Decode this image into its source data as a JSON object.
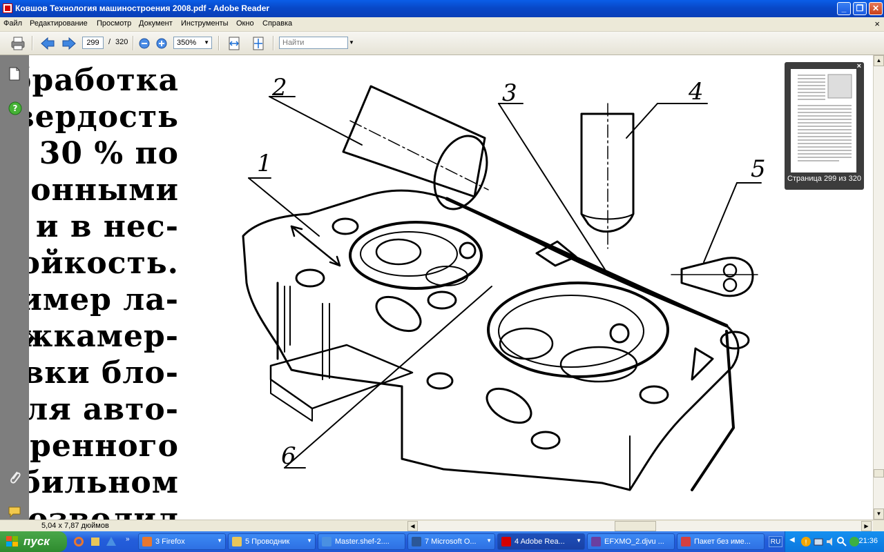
{
  "window": {
    "title": "Ковшов Технология машиностроения 2008.pdf - Adobe Reader",
    "minimize_glyph": "_",
    "maximize_glyph": "❐",
    "close_glyph": "✕"
  },
  "menu": {
    "items": [
      "Файл",
      "Редактирование",
      "Просмотр",
      "Документ",
      "Инструменты",
      "Окно",
      "Справка"
    ],
    "close_glyph": "×"
  },
  "toolbar": {
    "current_page": "299",
    "page_separator": "/",
    "total_pages": "320",
    "zoom": "350%",
    "search_placeholder": "Найти"
  },
  "document": {
    "text_lines": [
      "обработка",
      "твердость",
      "30 %   по",
      "ционными",
      "и  в  нес-",
      "тойкость.",
      "имер  ла-",
      "ежкамер-",
      "овки  бло-",
      "еля  авто-",
      "едренного",
      "обильном",
      "позволил"
    ],
    "figure_labels": [
      "1",
      "2",
      "3",
      "4",
      "5",
      "6"
    ]
  },
  "thumbnail": {
    "label": "Страница 299 из 320",
    "close_glyph": "×"
  },
  "status": {
    "page_size": "5,04 x 7,87 дюймов"
  },
  "taskbar": {
    "start_label": "пуск",
    "buttons": [
      {
        "label": "3 Firefox",
        "color": "#e8772e",
        "active": false
      },
      {
        "label": "5 Проводник",
        "color": "#e8c65a",
        "active": false
      },
      {
        "label": "Master.shef-2....",
        "color": "#4a90e2",
        "active": false
      },
      {
        "label": "7 Microsoft O...",
        "color": "#2b5797",
        "active": false
      },
      {
        "label": "4 Adobe Rea...",
        "color": "#d40000",
        "active": true
      },
      {
        "label": "EFXMO_2.djvu ...",
        "color": "#6a3fa0",
        "active": false
      },
      {
        "label": "Пакет без име...",
        "color": "#d44040",
        "active": false
      }
    ],
    "language": "RU",
    "clock": "21:36"
  }
}
